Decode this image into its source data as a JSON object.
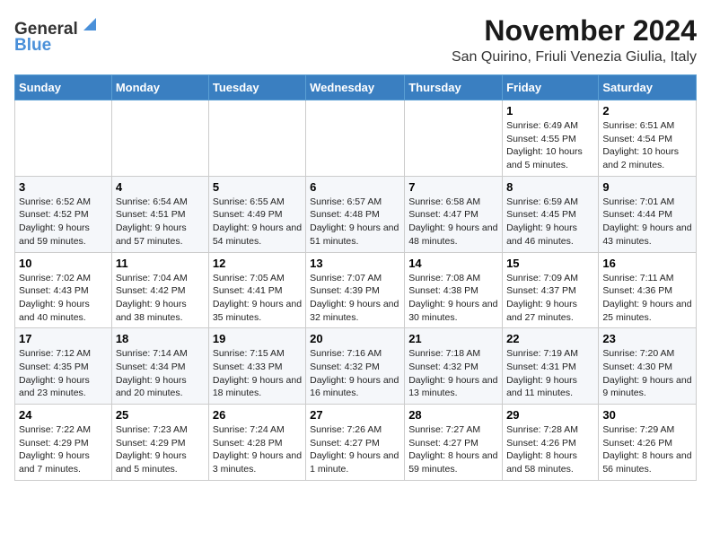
{
  "header": {
    "logo_general": "General",
    "logo_blue": "Blue",
    "title": "November 2024",
    "subtitle": "San Quirino, Friuli Venezia Giulia, Italy"
  },
  "calendar": {
    "days_of_week": [
      "Sunday",
      "Monday",
      "Tuesday",
      "Wednesday",
      "Thursday",
      "Friday",
      "Saturday"
    ],
    "weeks": [
      [
        {
          "day": "",
          "info": ""
        },
        {
          "day": "",
          "info": ""
        },
        {
          "day": "",
          "info": ""
        },
        {
          "day": "",
          "info": ""
        },
        {
          "day": "",
          "info": ""
        },
        {
          "day": "1",
          "info": "Sunrise: 6:49 AM\nSunset: 4:55 PM\nDaylight: 10 hours and 5 minutes."
        },
        {
          "day": "2",
          "info": "Sunrise: 6:51 AM\nSunset: 4:54 PM\nDaylight: 10 hours and 2 minutes."
        }
      ],
      [
        {
          "day": "3",
          "info": "Sunrise: 6:52 AM\nSunset: 4:52 PM\nDaylight: 9 hours and 59 minutes."
        },
        {
          "day": "4",
          "info": "Sunrise: 6:54 AM\nSunset: 4:51 PM\nDaylight: 9 hours and 57 minutes."
        },
        {
          "day": "5",
          "info": "Sunrise: 6:55 AM\nSunset: 4:49 PM\nDaylight: 9 hours and 54 minutes."
        },
        {
          "day": "6",
          "info": "Sunrise: 6:57 AM\nSunset: 4:48 PM\nDaylight: 9 hours and 51 minutes."
        },
        {
          "day": "7",
          "info": "Sunrise: 6:58 AM\nSunset: 4:47 PM\nDaylight: 9 hours and 48 minutes."
        },
        {
          "day": "8",
          "info": "Sunrise: 6:59 AM\nSunset: 4:45 PM\nDaylight: 9 hours and 46 minutes."
        },
        {
          "day": "9",
          "info": "Sunrise: 7:01 AM\nSunset: 4:44 PM\nDaylight: 9 hours and 43 minutes."
        }
      ],
      [
        {
          "day": "10",
          "info": "Sunrise: 7:02 AM\nSunset: 4:43 PM\nDaylight: 9 hours and 40 minutes."
        },
        {
          "day": "11",
          "info": "Sunrise: 7:04 AM\nSunset: 4:42 PM\nDaylight: 9 hours and 38 minutes."
        },
        {
          "day": "12",
          "info": "Sunrise: 7:05 AM\nSunset: 4:41 PM\nDaylight: 9 hours and 35 minutes."
        },
        {
          "day": "13",
          "info": "Sunrise: 7:07 AM\nSunset: 4:39 PM\nDaylight: 9 hours and 32 minutes."
        },
        {
          "day": "14",
          "info": "Sunrise: 7:08 AM\nSunset: 4:38 PM\nDaylight: 9 hours and 30 minutes."
        },
        {
          "day": "15",
          "info": "Sunrise: 7:09 AM\nSunset: 4:37 PM\nDaylight: 9 hours and 27 minutes."
        },
        {
          "day": "16",
          "info": "Sunrise: 7:11 AM\nSunset: 4:36 PM\nDaylight: 9 hours and 25 minutes."
        }
      ],
      [
        {
          "day": "17",
          "info": "Sunrise: 7:12 AM\nSunset: 4:35 PM\nDaylight: 9 hours and 23 minutes."
        },
        {
          "day": "18",
          "info": "Sunrise: 7:14 AM\nSunset: 4:34 PM\nDaylight: 9 hours and 20 minutes."
        },
        {
          "day": "19",
          "info": "Sunrise: 7:15 AM\nSunset: 4:33 PM\nDaylight: 9 hours and 18 minutes."
        },
        {
          "day": "20",
          "info": "Sunrise: 7:16 AM\nSunset: 4:32 PM\nDaylight: 9 hours and 16 minutes."
        },
        {
          "day": "21",
          "info": "Sunrise: 7:18 AM\nSunset: 4:32 PM\nDaylight: 9 hours and 13 minutes."
        },
        {
          "day": "22",
          "info": "Sunrise: 7:19 AM\nSunset: 4:31 PM\nDaylight: 9 hours and 11 minutes."
        },
        {
          "day": "23",
          "info": "Sunrise: 7:20 AM\nSunset: 4:30 PM\nDaylight: 9 hours and 9 minutes."
        }
      ],
      [
        {
          "day": "24",
          "info": "Sunrise: 7:22 AM\nSunset: 4:29 PM\nDaylight: 9 hours and 7 minutes."
        },
        {
          "day": "25",
          "info": "Sunrise: 7:23 AM\nSunset: 4:29 PM\nDaylight: 9 hours and 5 minutes."
        },
        {
          "day": "26",
          "info": "Sunrise: 7:24 AM\nSunset: 4:28 PM\nDaylight: 9 hours and 3 minutes."
        },
        {
          "day": "27",
          "info": "Sunrise: 7:26 AM\nSunset: 4:27 PM\nDaylight: 9 hours and 1 minute."
        },
        {
          "day": "28",
          "info": "Sunrise: 7:27 AM\nSunset: 4:27 PM\nDaylight: 8 hours and 59 minutes."
        },
        {
          "day": "29",
          "info": "Sunrise: 7:28 AM\nSunset: 4:26 PM\nDaylight: 8 hours and 58 minutes."
        },
        {
          "day": "30",
          "info": "Sunrise: 7:29 AM\nSunset: 4:26 PM\nDaylight: 8 hours and 56 minutes."
        }
      ]
    ]
  }
}
